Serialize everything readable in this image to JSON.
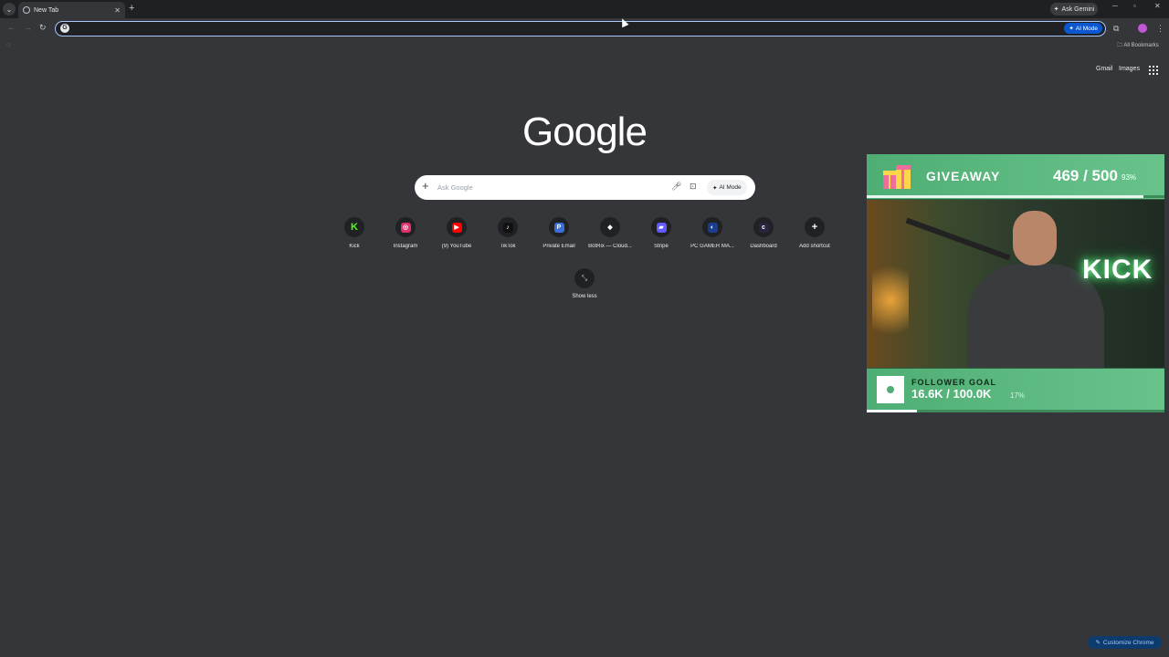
{
  "tab": {
    "title": "New Tab"
  },
  "titlebar": {
    "ask_gemini": "Ask Gemini"
  },
  "omnibox": {
    "value": "",
    "ai_mode_label": "AI Mode"
  },
  "bookmarks": {
    "all_bookmarks": "All Bookmarks"
  },
  "toplinks": {
    "gmail": "Gmail",
    "images": "Images"
  },
  "logo": {
    "text": "Google"
  },
  "search": {
    "placeholder": "Ask Google",
    "ai_mode_label": "AI Mode"
  },
  "shortcuts": [
    {
      "label": "Kick",
      "icon": "kick-icon",
      "glyph": "K",
      "color": "#53fc18"
    },
    {
      "label": "Instagram",
      "icon": "instagram-icon",
      "glyph": "◎",
      "color": "#e1306c"
    },
    {
      "label": "(9) YouTube",
      "icon": "youtube-icon",
      "glyph": "▶",
      "color": "#ff0000"
    },
    {
      "label": "TikTok",
      "icon": "tiktok-icon",
      "glyph": "♪",
      "color": "#111111"
    },
    {
      "label": "Private Email",
      "icon": "private-email-icon",
      "glyph": "P",
      "color": "#3b6fd8"
    },
    {
      "label": "BotRix — Cloud...",
      "icon": "botrix-icon",
      "glyph": "◆",
      "color": "#202124"
    },
    {
      "label": "Stripe",
      "icon": "stripe-icon",
      "glyph": "▰",
      "color": "#635bff"
    },
    {
      "label": "PC GAMER MA...",
      "icon": "pc-gamer-icon",
      "glyph": "◐",
      "color": "#1a3d8f"
    },
    {
      "label": "Dashboard",
      "icon": "dashboard-icon",
      "glyph": "c",
      "color": "#2a2340"
    },
    {
      "label": "Add shortcut",
      "icon": "plus-icon",
      "glyph": "+",
      "color": "#202124"
    }
  ],
  "show_less": {
    "label": "Show less"
  },
  "giveaway": {
    "title": "GIVEAWAY",
    "count": "469 / 500",
    "percent": "93%",
    "progress": 0.93
  },
  "follower_goal": {
    "title": "FOLLOWER GOAL",
    "count": "16.6K / 100.0K",
    "percent": "17%",
    "progress": 0.17
  },
  "webcam": {
    "neon_sign": "KICK"
  },
  "customize": {
    "label": "Customize Chrome"
  }
}
